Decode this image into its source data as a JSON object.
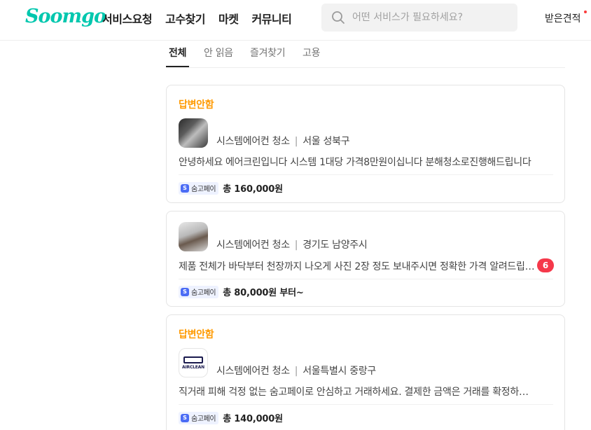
{
  "header": {
    "logo": "Soomgo",
    "nav": [
      "서비스요청",
      "고수찾기",
      "마켓",
      "커뮤니티"
    ],
    "search_placeholder": "어떤 서비스가 필요하세요?",
    "received_quotes": "받은견적"
  },
  "tabs": [
    {
      "label": "전체",
      "active": true
    },
    {
      "label": "안 읽음",
      "active": false
    },
    {
      "label": "즐겨찾기",
      "active": false
    },
    {
      "label": "고용",
      "active": false
    }
  ],
  "chats": [
    {
      "status": "답변안함",
      "service": "시스템에어컨 청소",
      "location": "서울 성북구",
      "message": "안녕하세요 에어크린입니다 시스템 1대당 가격8만원이십니다 분해청소로진행해드립니다",
      "pay_label": "숨고페이",
      "price": "총 160,000원"
    },
    {
      "status": "",
      "service": "시스템에어컨 청소",
      "location": "경기도 남양주시",
      "message": "제품 전체가 바닥부터 천장까지 나오게 사진 2장 정도 보내주시면 정확한 가격 알려드립니다",
      "unread": "6",
      "pay_label": "숨고페이",
      "price": "총 80,000원 부터~"
    },
    {
      "status": "답변안함",
      "service": "시스템에어컨 청소",
      "location": "서울특별시 중랑구",
      "message": "직거래 피해 걱정 없는 숨고페이로 안심하고 거래하세요. 결제한 금액은 거래를 확정하기 전까지",
      "pay_label": "숨고페이",
      "price": "총 140,000원",
      "thumb_logo": "AIRCLEAN"
    }
  ],
  "colors": {
    "brand": "#00c7ae",
    "status": "#ff9a00",
    "badge": "#f5384a",
    "pay": "#4b6cf5"
  }
}
